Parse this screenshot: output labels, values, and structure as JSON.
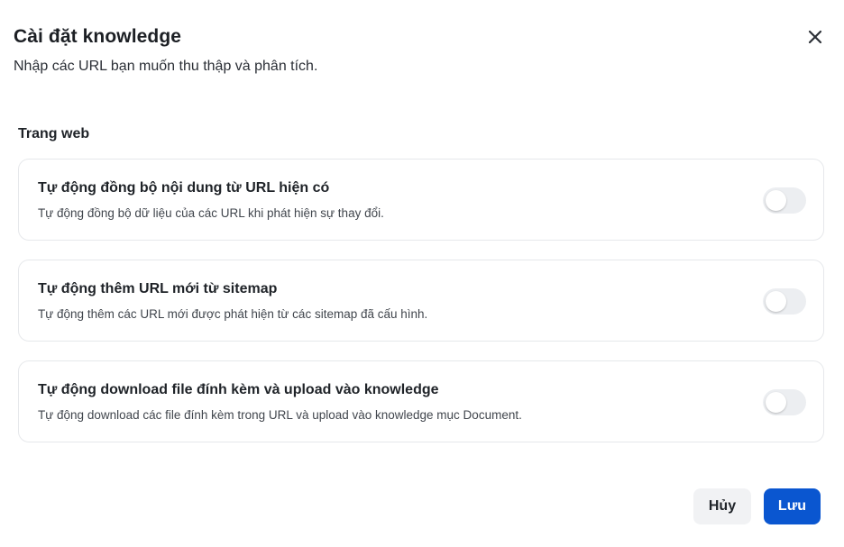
{
  "dialog": {
    "title": "Cài đặt knowledge",
    "subtitle": "Nhập các URL bạn muốn thu thập và phân tích.",
    "close_icon": "close-icon"
  },
  "section": {
    "label": "Trang web"
  },
  "settings": [
    {
      "title": "Tự động đồng bộ nội dung từ URL hiện có",
      "description": "Tự động đồng bộ dữ liệu của các URL khi phát hiện sự thay đổi.",
      "enabled": false
    },
    {
      "title": "Tự động thêm URL mới từ sitemap",
      "description": "Tự động thêm các URL mới được phát hiện từ các sitemap đã cấu hình.",
      "enabled": false
    },
    {
      "title": "Tự động download file đính kèm và upload vào knowledge",
      "description": "Tự động download các file đính kèm trong URL và upload vào knowledge mục Document.",
      "enabled": false
    }
  ],
  "footer": {
    "cancel_label": "Hủy",
    "save_label": "Lưu"
  },
  "colors": {
    "primary": "#0a56d0",
    "toggle_off": "#eceef1",
    "card_border": "#e6e8eb",
    "cancel_bg": "#f1f2f4"
  }
}
